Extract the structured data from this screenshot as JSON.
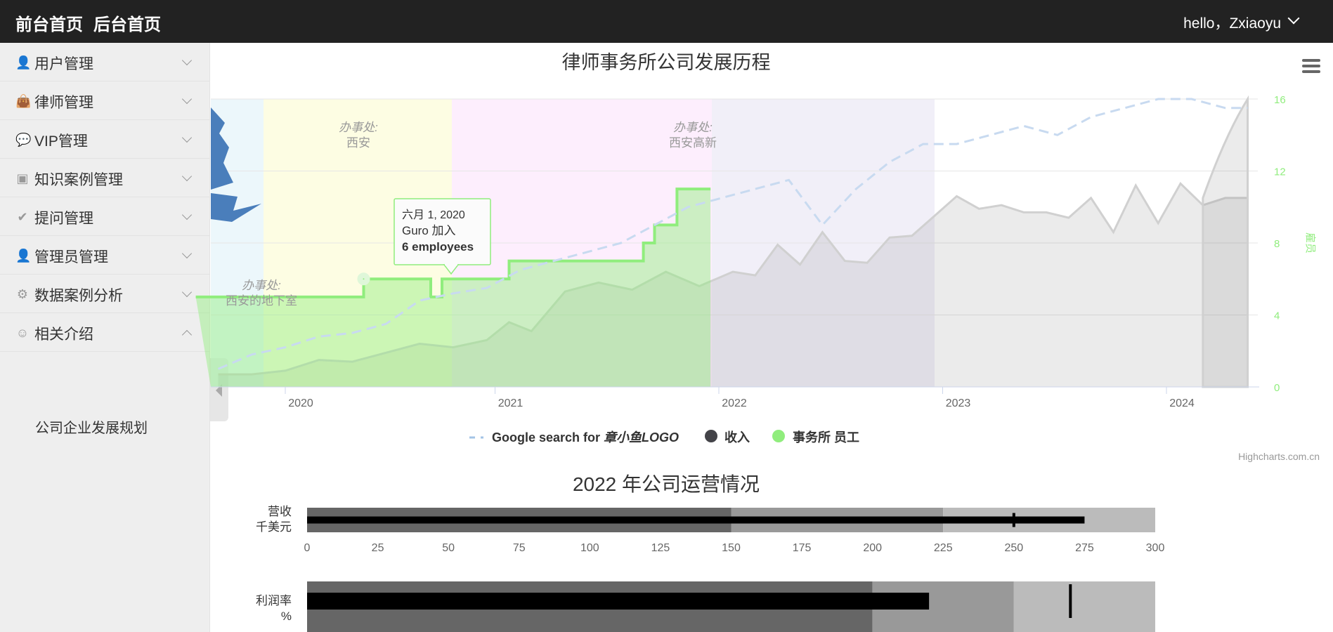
{
  "topbar": {
    "front_home": "前台首页",
    "back_home": "后台首页",
    "user_greeting": "hello，Zxiaoyu"
  },
  "sidebar": {
    "items": [
      {
        "label": "用户管理",
        "icon": "user-icon",
        "glyph": "👤",
        "expanded": false
      },
      {
        "label": "律师管理",
        "icon": "briefcase-icon",
        "glyph": "👜",
        "expanded": false
      },
      {
        "label": "VIP管理",
        "icon": "chat-icon",
        "glyph": "💬",
        "expanded": false
      },
      {
        "label": "知识案例管理",
        "icon": "media-icon",
        "glyph": "▣",
        "expanded": false
      },
      {
        "label": "提问管理",
        "icon": "check-circle-icon",
        "glyph": "✔",
        "expanded": false
      },
      {
        "label": "管理员管理",
        "icon": "person-icon",
        "glyph": "👤",
        "expanded": false
      },
      {
        "label": "数据案例分析",
        "icon": "chart-icon",
        "glyph": "⚙",
        "expanded": false
      },
      {
        "label": "相关介绍",
        "icon": "face-icon",
        "glyph": "☺",
        "expanded": true
      }
    ],
    "submenu": {
      "label": "公司企业发展规划"
    }
  },
  "chart1": {
    "title": "律师事务所公司发展历程",
    "right_axis_label": "雇员",
    "credits": "Highcharts.com.cn",
    "bands": [
      {
        "title": "办事处:",
        "name": "西安的地下室"
      },
      {
        "title": "办事处:",
        "name": "西安"
      },
      {
        "title": "办事处:",
        "name": "西安高新"
      }
    ],
    "tooltip": {
      "date": "六月 1, 2020",
      "event": "Guro 加入",
      "value": "6 employees"
    },
    "legend": [
      {
        "prefix": "Google search for ",
        "italic": "章小鱼LOGO",
        "color": "#90b4d8"
      },
      {
        "label": "收入",
        "color": "#434348"
      },
      {
        "label": "事务所 员工",
        "color": "#90ed7d"
      }
    ]
  },
  "chart_data": [
    {
      "type": "area",
      "title": "律师事务所公司发展历程",
      "x_ticks": [
        "2020",
        "2021",
        "2022",
        "2023",
        "2024"
      ],
      "y_ticks": [
        "0",
        "4",
        "8",
        "12",
        "16"
      ],
      "ylim": [
        0,
        16
      ],
      "series": [
        {
          "name": "Google search for 章小鱼LOGO",
          "color": "#a3c4e6",
          "dashed": true,
          "x": [
            2019.7,
            2019.85,
            2020.0,
            2020.15,
            2020.3,
            2020.45,
            2020.6,
            2020.75,
            2020.9,
            2021.05,
            2021.2,
            2021.35,
            2021.5,
            2021.65,
            2021.8,
            2021.95,
            2022.1,
            2022.25,
            2022.4,
            2022.55,
            2022.7,
            2022.85,
            2023.0,
            2023.15,
            2023.3,
            2023.45,
            2023.6,
            2023.75,
            2023.9,
            2024.05,
            2024.2,
            2024.3
          ],
          "values": [
            1.0,
            1.8,
            2.2,
            2.8,
            3.0,
            3.5,
            4.8,
            5.2,
            5.5,
            6.5,
            7.0,
            7.5,
            8.0,
            9.0,
            10.0,
            10.5,
            11.0,
            11.5,
            9.0,
            11.0,
            12.5,
            13.5,
            13.5,
            14.0,
            14.5,
            14.0,
            15.0,
            15.5,
            16.0,
            16.0,
            15.5,
            15.5
          ]
        },
        {
          "name": "收入",
          "color": "#b5b5b5",
          "x": [
            2019.7,
            2019.85,
            2020.0,
            2020.15,
            2020.3,
            2020.45,
            2020.6,
            2020.75,
            2020.9,
            2021.0,
            2021.1,
            2021.25,
            2021.4,
            2021.55,
            2021.7,
            2021.85,
            2022.0,
            2022.1,
            2022.2,
            2022.3,
            2022.4,
            2022.5,
            2022.6,
            2022.7,
            2022.8,
            2022.9,
            2023.0,
            2023.1,
            2023.2,
            2023.3,
            2023.4,
            2023.5,
            2023.6,
            2023.7,
            2023.8,
            2023.9,
            2024.0,
            2024.1,
            2024.2,
            2024.3
          ],
          "values": [
            0.7,
            0.7,
            0.9,
            1.5,
            1.4,
            1.9,
            2.4,
            2.2,
            2.6,
            3.6,
            3.1,
            5.3,
            5.8,
            5.4,
            6.4,
            5.6,
            6.4,
            6.2,
            7.9,
            6.8,
            8.6,
            7.0,
            6.9,
            8.3,
            8.4,
            9.5,
            10.6,
            9.9,
            10.1,
            9.7,
            9.7,
            9.4,
            10.5,
            8.6,
            11.2,
            9.1,
            11.3,
            10.1,
            10.5,
            10.5
          ]
        },
        {
          "name": "事务所 员工",
          "color": "#90ed7d",
          "step": true,
          "x": [
            2019.6,
            2020.35,
            2020.35,
            2020.65,
            2020.65,
            2020.7,
            2020.7,
            2021.0,
            2021.0,
            2021.6,
            2021.6,
            2021.65,
            2021.65,
            2021.75,
            2021.75,
            2021.9
          ],
          "values": [
            5,
            5,
            6,
            6,
            5,
            5,
            6,
            6,
            7,
            7,
            8,
            8,
            9,
            9,
            11,
            11
          ]
        }
      ]
    },
    {
      "type": "bar",
      "title": "2022 年公司运营情况",
      "rows": [
        {
          "label_line1": "营收",
          "label_line2": "千美元",
          "value": 275,
          "target": 250,
          "bands": [
            150,
            225,
            300
          ],
          "ticks": [
            "0",
            "25",
            "50",
            "75",
            "100",
            "125",
            "150",
            "175",
            "200",
            "225",
            "250",
            "275",
            "300"
          ],
          "xlim": [
            0,
            300
          ]
        },
        {
          "label_line1": "利润率",
          "label_line2": "%",
          "value": 22,
          "target": 27,
          "bands": [
            20,
            25,
            30
          ],
          "xlim": [
            0,
            30
          ]
        }
      ]
    }
  ]
}
